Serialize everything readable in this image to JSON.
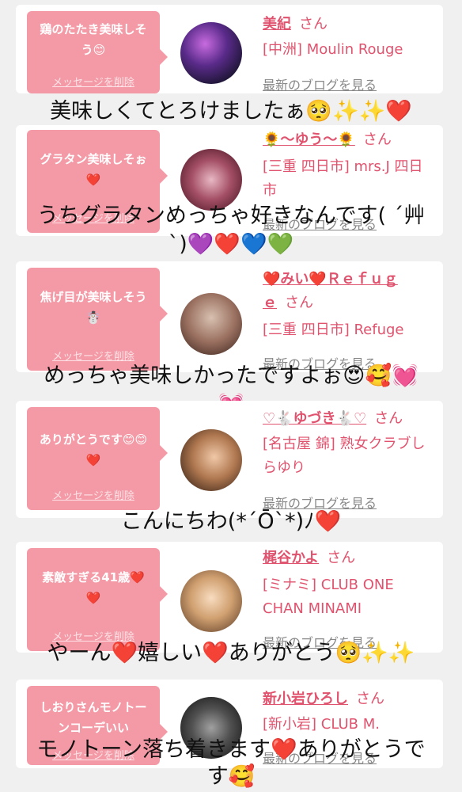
{
  "delete_label": "メッセージを削除",
  "honorific": "さん",
  "blog_label": "最新のブログを見る",
  "cards": [
    {
      "message": "鶏のたたき美味しそう😊",
      "name": "美紀",
      "shop": "[中洲] Moulin Rouge",
      "comment": "美味しくてとろけましたぁ🥺✨✨❤️"
    },
    {
      "message": "グラタン美味しそぉ❤️",
      "name": "🌻〜ゆう〜🌻",
      "shop": "[三重 四日市] mrs.J 四日市",
      "comment_line1": "うちグラタンめっちゃ好きなんです( ´艸",
      "comment_line2": "`)💜❤️💙💚"
    },
    {
      "message": "焦げ目が美味しそう☃️",
      "name_line1": "❤️みい❤️Ｒｅｆｕｇ",
      "name_line2": "ｅ",
      "shop": "[三重 四日市] Refuge",
      "comment": "めっちゃ美味しかったですよぉ😍🥰💓"
    },
    {
      "message": "ありがとうです😊😊❤️",
      "name": "♡🐇ゆづき🐇♡",
      "shop": "[名古屋 錦] 熟女クラブしらゆり",
      "comment": "こんにちわ(*´Ō`*)ﾉ❤️"
    },
    {
      "message": "素敵すぎる41歳❤️❤️",
      "name": "梶谷かよ",
      "shop": "[ミナミ] CLUB ONE CHAN MINAMI",
      "comment": "やーん❤️嬉しい❤️ありがとう🥺✨✨"
    },
    {
      "message": "しおりさんモノトーンコーデいい",
      "name": "新小岩ひろし",
      "shop": "[新小岩] CLUB M.",
      "comment_line1": "モノトーン落ち着きます❤️ありがとうで",
      "comment_line2": "す🥰"
    }
  ],
  "sticker_heart": "💓"
}
